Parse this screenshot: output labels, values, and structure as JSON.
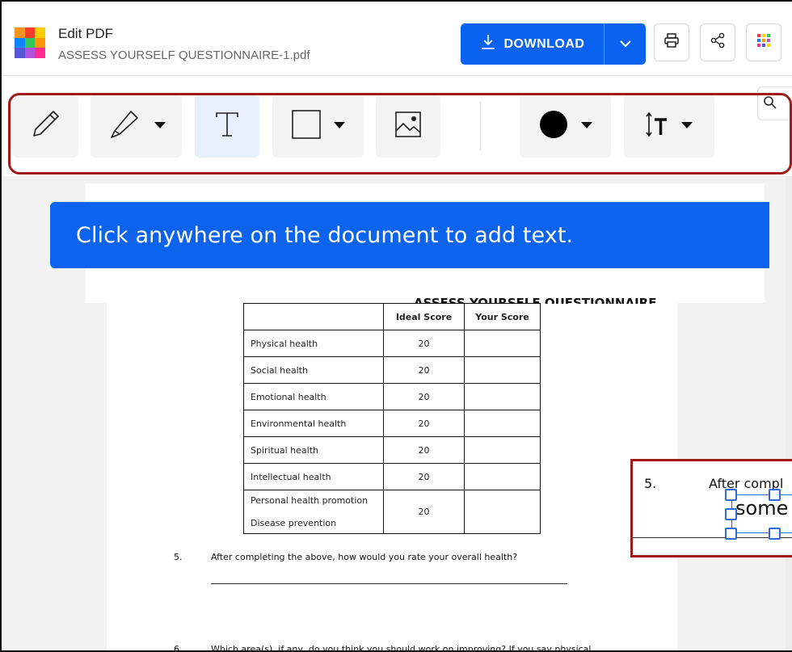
{
  "header": {
    "app_title": "Edit PDF",
    "file_name": "ASSESS YOURSELF QUESTIONNAIRE-1.pdf",
    "download_label": "DOWNLOAD",
    "icons": [
      "download-icon",
      "chevron-down-icon",
      "print-icon",
      "share-icon",
      "apps-grid-icon"
    ]
  },
  "toolbar": {
    "tools": [
      {
        "name": "pencil-tool",
        "icon": "pencil-icon"
      },
      {
        "name": "highlighter-tool",
        "icon": "marker-icon"
      },
      {
        "name": "text-tool",
        "icon": "text-cursor-icon",
        "active": true
      },
      {
        "name": "shape-tool",
        "icon": "square-icon"
      },
      {
        "name": "image-tool",
        "icon": "image-icon"
      },
      {
        "name": "color-tool",
        "icon": "color-circle-icon",
        "value": "#000000"
      },
      {
        "name": "text-size-tool",
        "icon": "text-size-icon"
      }
    ]
  },
  "toast": {
    "message": "Click anywhere on the document to add text."
  },
  "document": {
    "title": "ASSESS YOURSELF QUESTIONNAIRE",
    "table": {
      "headers": [
        "",
        "Ideal Score",
        "Your Score"
      ],
      "rows": [
        {
          "label": "Physical health",
          "ideal": "20",
          "yours": ""
        },
        {
          "label": "Social health",
          "ideal": "20",
          "yours": ""
        },
        {
          "label": "Emotional health",
          "ideal": "20",
          "yours": ""
        },
        {
          "label": "Environmental health",
          "ideal": "20",
          "yours": ""
        },
        {
          "label": "Spiritual health",
          "ideal": "20",
          "yours": ""
        },
        {
          "label": "Intellectual health",
          "ideal": "20",
          "yours": ""
        }
      ],
      "last_row": {
        "label_1": "Personal health promotion",
        "label_2": "Disease prevention",
        "ideal": "20",
        "yours": ""
      }
    },
    "q5": {
      "num": "5.",
      "text": "After completing the above, how would you rate your overall health?"
    },
    "q6": {
      "num": "6.",
      "text": "Which area(s), if any, do you think you should work on improving? If you say physical,"
    }
  },
  "zoom": {
    "num": "5.",
    "text": "After compl",
    "textbox_value": "some"
  },
  "colors": {
    "brand_blue": "#0a63f0",
    "highlight_red": "#a11a1a",
    "selection_blue": "#2e6bd6"
  }
}
